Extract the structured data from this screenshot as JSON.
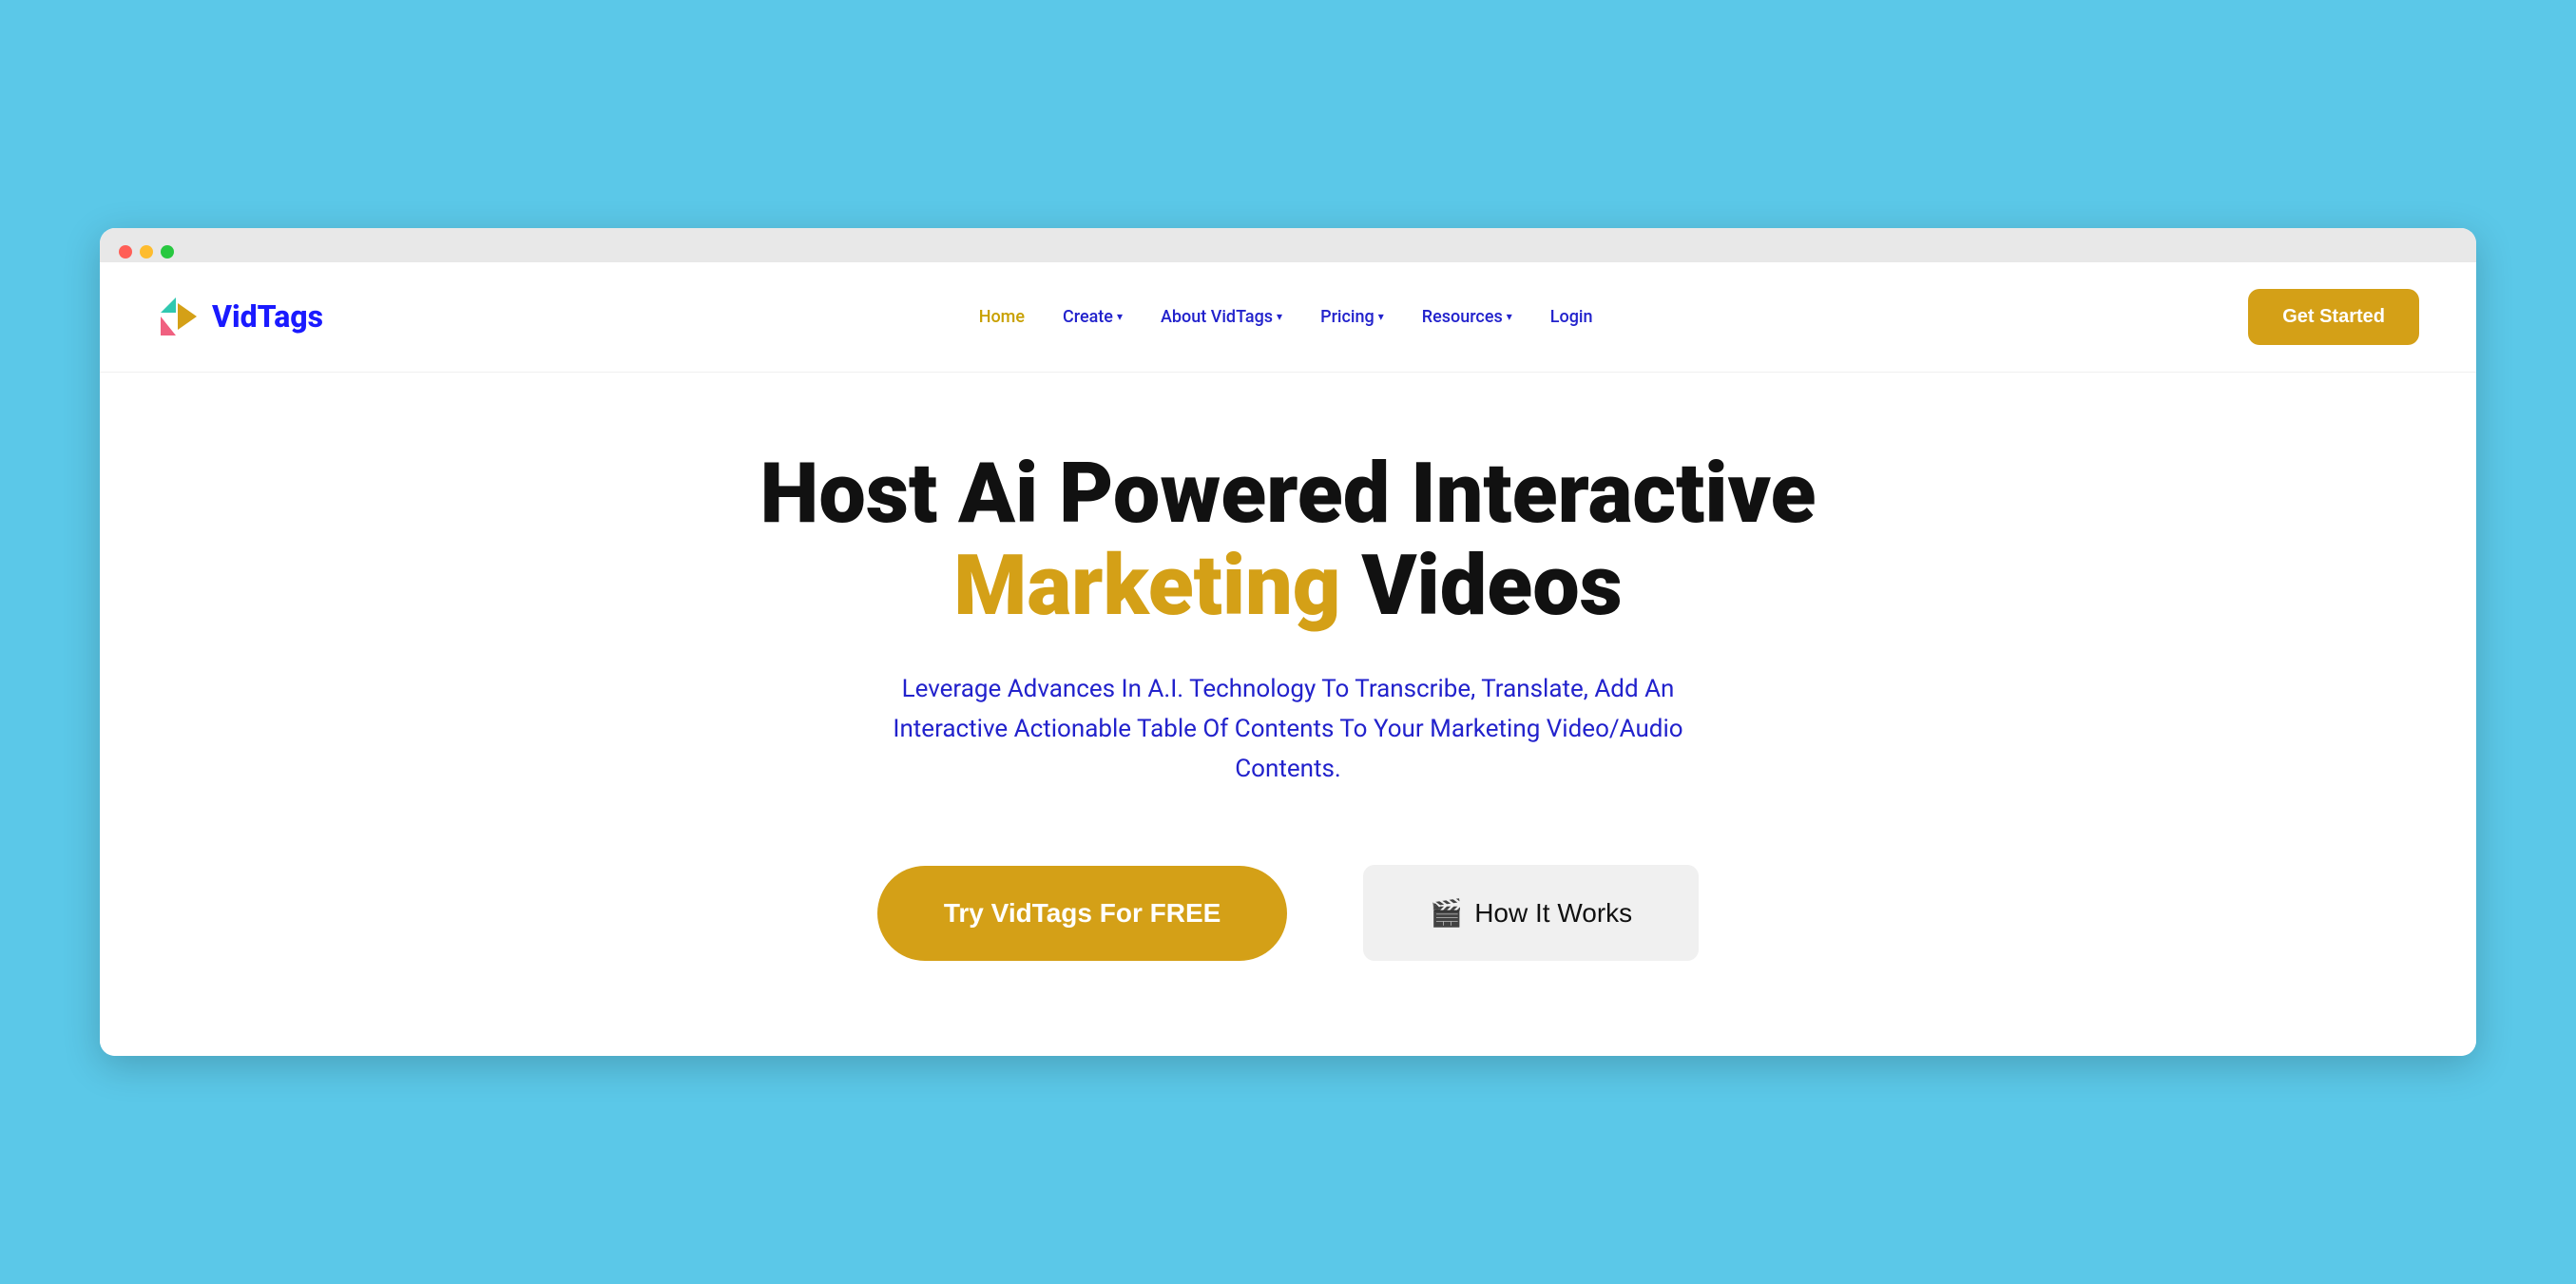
{
  "browser": {
    "dots": [
      "red",
      "yellow",
      "green"
    ]
  },
  "navbar": {
    "logo_text": "VidTags",
    "links": [
      {
        "label": "Home",
        "active": true,
        "has_dropdown": false
      },
      {
        "label": "Create",
        "active": false,
        "has_dropdown": true
      },
      {
        "label": "About VidTags",
        "active": false,
        "has_dropdown": true
      },
      {
        "label": "Pricing",
        "active": false,
        "has_dropdown": true
      },
      {
        "label": "Resources",
        "active": false,
        "has_dropdown": true
      },
      {
        "label": "Login",
        "active": false,
        "has_dropdown": false
      }
    ],
    "cta_button": "Get Started"
  },
  "hero": {
    "title_line1": "Host Ai Powered Interactive",
    "title_line2_highlight": "Marketing",
    "title_line2_rest": " Videos",
    "subtitle": "Leverage Advances In A.I. Technology To Transcribe, Translate, Add An Interactive Actionable Table Of Contents To Your Marketing Video/Audio Contents.",
    "btn_primary": "Try VidTags For FREE",
    "btn_secondary_icon": "🎬",
    "btn_secondary_text": "How It Works"
  },
  "colors": {
    "accent_gold": "#d4a017",
    "nav_blue": "#2222cc",
    "bg_light": "#5bc8e8",
    "text_dark": "#111111",
    "btn_secondary_bg": "#f0f0f0"
  }
}
